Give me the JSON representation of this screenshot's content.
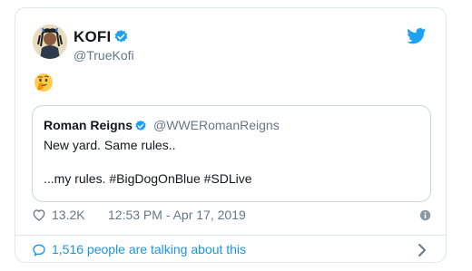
{
  "tweet": {
    "author_name": "KOFI",
    "author_handle": "@TrueKofi",
    "emoji": "🤔"
  },
  "quoted_tweet": {
    "author_name": "Roman Reigns",
    "author_handle": "@WWERomanReigns",
    "line1": "New yard. Same rules..",
    "line2": "...my rules. #BigDogOnBlue #SDLive"
  },
  "meta": {
    "likes": "13.2K",
    "timestamp": "12:53 PM - Apr 17, 2019"
  },
  "footer": {
    "talking": "1,516 people are talking about this"
  },
  "colors": {
    "accent": "#1da1f2",
    "link": "#1b95e0",
    "secondary_text": "#657786"
  },
  "icons": [
    "verified-badge-icon",
    "twitter-bird-icon",
    "heart-icon",
    "info-icon",
    "speech-bubble-icon",
    "chevron-right-icon"
  ]
}
